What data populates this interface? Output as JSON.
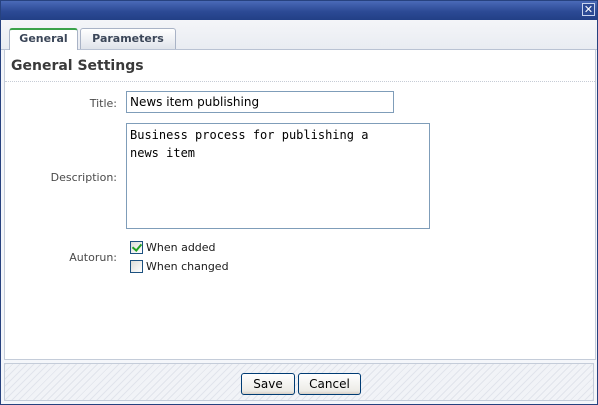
{
  "window": {
    "close_glyph": "✕"
  },
  "tabs": [
    {
      "label": "General",
      "active": true
    },
    {
      "label": "Parameters",
      "active": false
    }
  ],
  "section": {
    "title": "General Settings"
  },
  "form": {
    "title_label": "Title:",
    "title_value": "News item publishing",
    "description_label": "Description:",
    "description_value": "Business process for publishing a\nnews item",
    "autorun_label": "Autorun:",
    "autorun_options": [
      {
        "label": "When added",
        "checked": true
      },
      {
        "label": "When changed",
        "checked": false
      }
    ]
  },
  "footer": {
    "save_label": "Save",
    "cancel_label": "Cancel"
  },
  "colors": {
    "titlebar": "#2c4a95",
    "active_tab_accent": "#3aa24a",
    "check_mark": "#21a121"
  }
}
